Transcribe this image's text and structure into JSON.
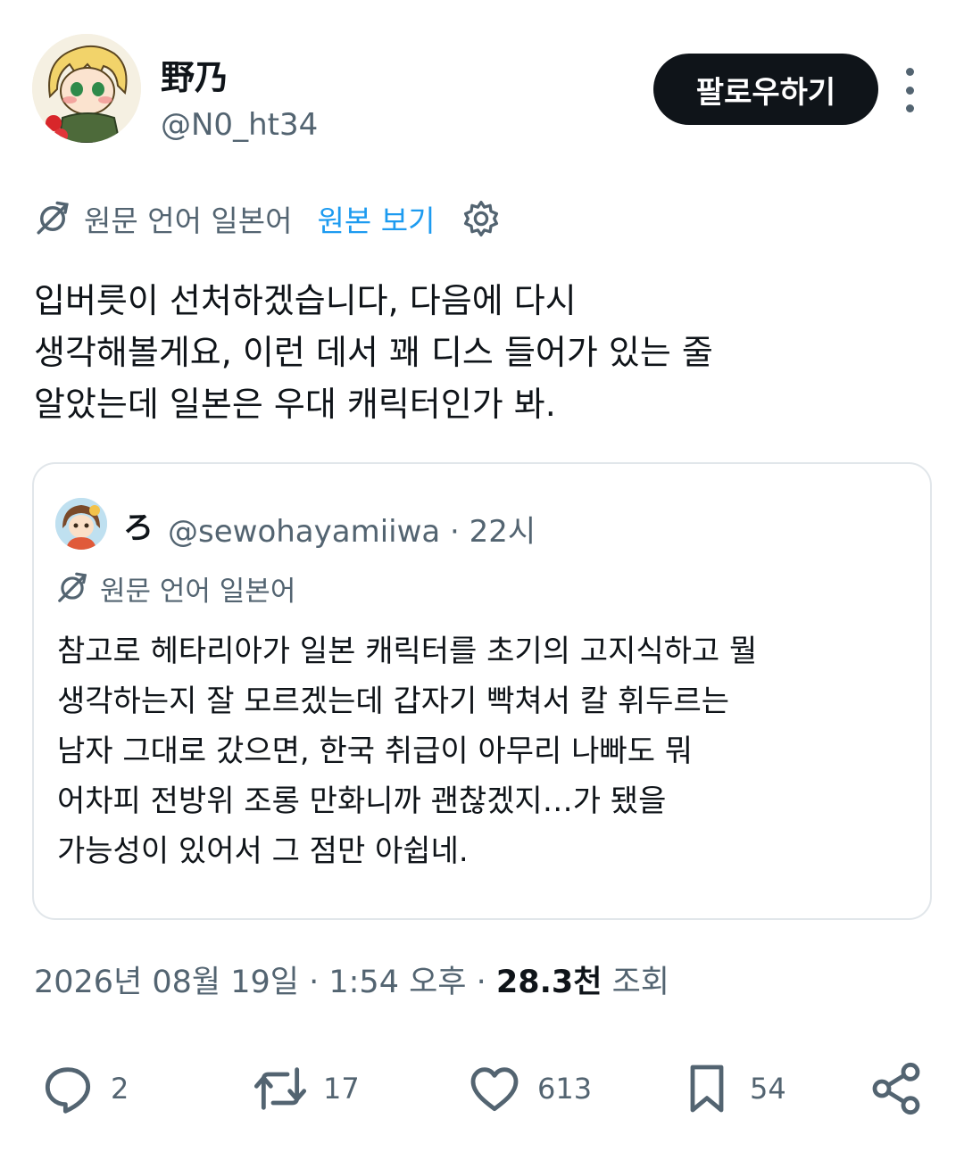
{
  "author": {
    "name": "野乃",
    "handle": "@N0_ht34",
    "follow_label": "팔로우하기"
  },
  "translation": {
    "source_language": "원문 언어 일본어",
    "show_original": "원본 보기"
  },
  "tweet": {
    "lines": [
      "입버릇이 선처하겠습니다, 다음에 다시",
      "생각해볼게요, 이런 데서 꽤 디스 들어가 있는 줄",
      "알았는데 일본은 우대 캐릭터인가 봐."
    ]
  },
  "quote": {
    "name": "ろ",
    "meta": "@sewohayamiiwa · 22시",
    "source_language": "원문 언어 일본어",
    "lines": [
      "참고로 헤타리아가 일본 캐릭터를 초기의 고지식하고 뭘",
      "생각하는지 잘 모르겠는데 갑자기 빡쳐서 칼 휘두르는",
      "남자 그대로 갔으면, 한국 취급이 아무리 나빠도 뭐",
      "어차피 전방위 조롱 만화니까 괜찮겠지…가 됐을",
      "가능성이 있어서 그 점만 아쉽네."
    ]
  },
  "meta": {
    "timestamp": "2026년 08월 19일 · 1:54 오후 ·",
    "views_count": "28.3천",
    "views_label": "조회"
  },
  "actions": {
    "replies": "2",
    "reposts": "17",
    "likes": "613",
    "bookmarks": "54"
  },
  "colors": {
    "text": "#0f1419",
    "secondary": "#536471",
    "link": "#1d9bf0",
    "border": "#e1e6ea"
  }
}
